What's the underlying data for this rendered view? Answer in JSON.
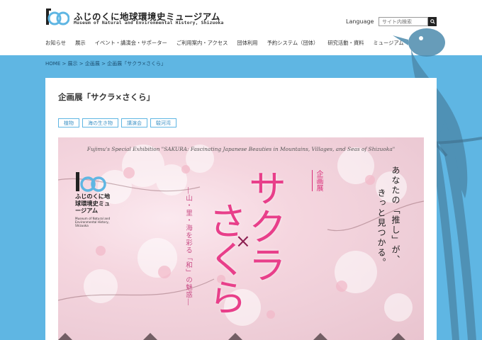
{
  "site": {
    "name_ja": "ふじのくに地球環境史ミュージアム",
    "name_en": "Museum of Natural and Environmental History, Shizuoka",
    "language_label": "Language",
    "search_placeholder": "サイト内検索"
  },
  "nav": [
    {
      "label": "お知らせ"
    },
    {
      "label": "展示"
    },
    {
      "label": "イベント・講演会・サポーター"
    },
    {
      "label": "ご利用案内・アクセス"
    },
    {
      "label": "団体利用"
    },
    {
      "label": "予約システム（団体）"
    },
    {
      "label": "研究活動・資料"
    },
    {
      "label": "ミュージアム"
    }
  ],
  "breadcrumb": "HOME > 展示 > 企画展 > 企画展「サクラ×さくら」",
  "page": {
    "title": "企画展「サクラ×さくら」",
    "tags": [
      {
        "label": "植物"
      },
      {
        "label": "海の生き物"
      },
      {
        "label": "講演会"
      },
      {
        "label": "駿河湾"
      }
    ]
  },
  "poster": {
    "subtitle": "Fujimu's Special Exhibition \"SAKURA: Fascinating Japanese Beauties in Mountains, Villages, and Seas of Shizuoka\"",
    "museum_ja": "ふじのくに地球環境史ミュージアム",
    "museum_en": "Museum of Natural and Environmental History, Shizuoka",
    "kikaku": "企画展",
    "big1": "サクラ",
    "cross": "×",
    "big2": "さくら",
    "tagline": "―山・里・海を彩る「和」の魅惑―",
    "catch1": "あなたの「推し」が、",
    "catch2": "きっと見つかる。"
  },
  "colors": {
    "sky": "#5fb6e3",
    "accent_pink": "#e83f8a",
    "tag_border": "#5fb6e3"
  }
}
